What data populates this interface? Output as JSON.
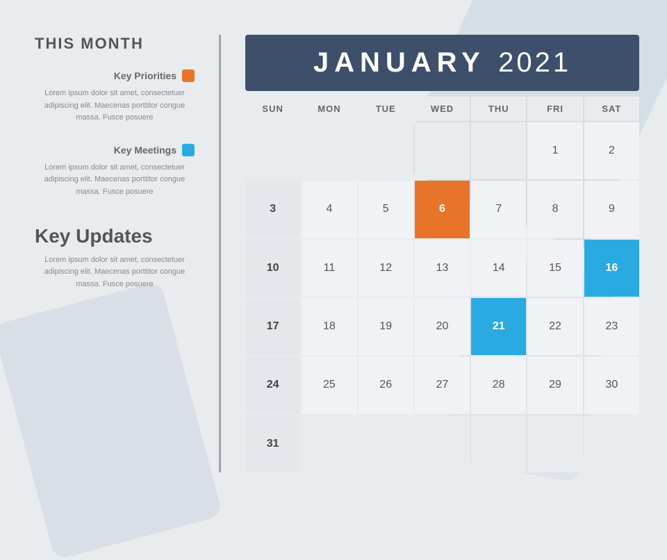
{
  "sidebar": {
    "title": "THIS MONTH",
    "key_priorities": {
      "label": "Key Priorities",
      "color": "orange",
      "text": "Lorem ipsum dolor sit amet, consectetuer adipiscing elit. Maecenas porttitor congue massa. Fusce posuere"
    },
    "key_meetings": {
      "label": "Key Meetings",
      "color": "blue",
      "text": "Lorem ipsum dolor sit amet, consectetuer adipiscing elit. Maecenas porttitor congue massa. Fusce posuere"
    },
    "key_updates": {
      "title": "Key Updates",
      "text": "Lorem ipsum dolor sit amet, consectetuer adipiscing elit. Maecenas porttitor congue massa. Fusce posuere"
    }
  },
  "calendar": {
    "month": "JANUARY",
    "year": "2021",
    "days_header": [
      "SUN",
      "MON",
      "TUE",
      "WED",
      "THU",
      "FRI",
      "SAT"
    ],
    "highlighted_orange": [
      6
    ],
    "highlighted_blue": [
      16,
      21
    ],
    "weeks": [
      [
        null,
        null,
        null,
        null,
        null,
        1,
        2
      ],
      [
        3,
        4,
        5,
        6,
        7,
        8,
        9
      ],
      [
        10,
        11,
        12,
        13,
        14,
        15,
        16
      ],
      [
        17,
        18,
        19,
        20,
        21,
        22,
        23
      ],
      [
        24,
        25,
        26,
        27,
        28,
        29,
        30
      ],
      [
        31,
        null,
        null,
        null,
        null,
        null,
        null
      ]
    ]
  }
}
